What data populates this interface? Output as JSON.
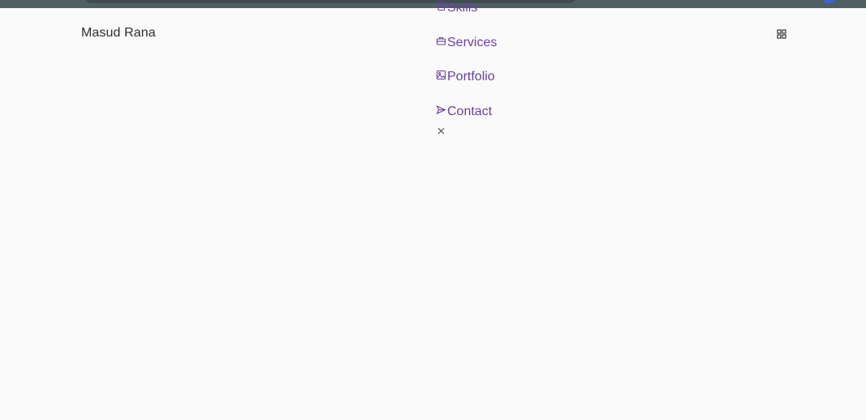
{
  "header": {
    "brand": "Masud Rana",
    "menu_icon": "grid-icon"
  },
  "nav": {
    "items": [
      {
        "label": "Skills",
        "icon": "file-icon"
      },
      {
        "label": "Services",
        "icon": "briefcase-icon"
      },
      {
        "label": "Portfolio",
        "icon": "image-icon"
      },
      {
        "label": "Contact",
        "icon": "send-icon"
      }
    ],
    "close_icon": "close-icon"
  },
  "colors": {
    "accent": "#6a3fa0",
    "text": "#2e2e2e",
    "background": "#fafafa",
    "topbar": "#4f5f66"
  }
}
